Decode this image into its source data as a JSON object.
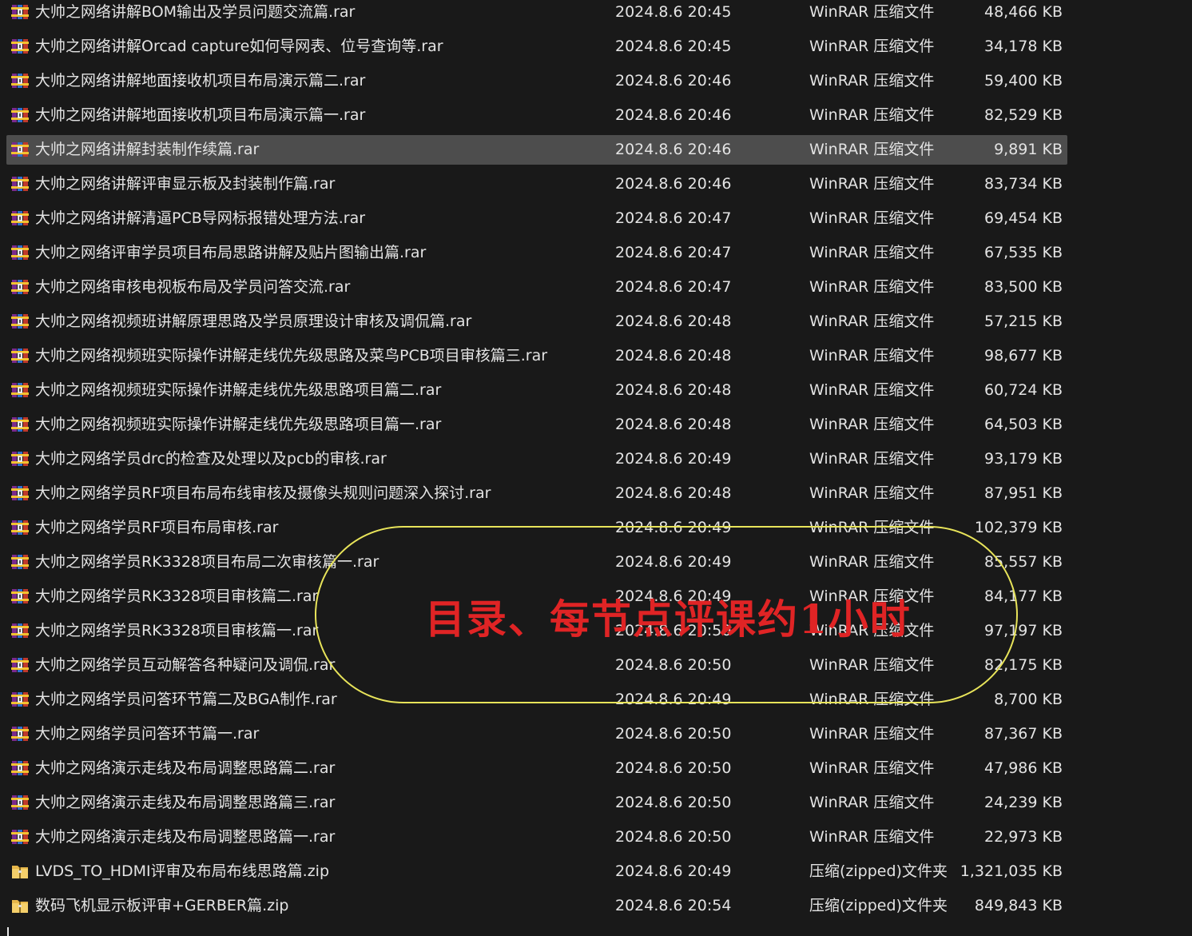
{
  "files": [
    {
      "name": "大帅之网络讲解BOM输出及学员问题交流篇.rar",
      "date": "2024.8.6 20:45",
      "type": "WinRAR 压缩文件",
      "size": "48,466 KB",
      "icon": "winrar-archive-icon"
    },
    {
      "name": "大帅之网络讲解Orcad capture如何导网表、位号查询等.rar",
      "date": "2024.8.6 20:45",
      "type": "WinRAR 压缩文件",
      "size": "34,178 KB",
      "icon": "winrar-archive-icon"
    },
    {
      "name": "大帅之网络讲解地面接收机项目布局演示篇二.rar",
      "date": "2024.8.6 20:46",
      "type": "WinRAR 压缩文件",
      "size": "59,400 KB",
      "icon": "winrar-archive-icon"
    },
    {
      "name": "大帅之网络讲解地面接收机项目布局演示篇一.rar",
      "date": "2024.8.6 20:46",
      "type": "WinRAR 压缩文件",
      "size": "82,529 KB",
      "icon": "winrar-archive-icon"
    },
    {
      "name": "大帅之网络讲解封装制作续篇.rar",
      "date": "2024.8.6 20:46",
      "type": "WinRAR 压缩文件",
      "size": "9,891 KB",
      "icon": "winrar-archive-icon",
      "selected": true
    },
    {
      "name": "大帅之网络讲解评审显示板及封装制作篇.rar",
      "date": "2024.8.6 20:46",
      "type": "WinRAR 压缩文件",
      "size": "83,734 KB",
      "icon": "winrar-archive-icon"
    },
    {
      "name": "大帅之网络讲解清逼PCB导网标报错处理方法.rar",
      "date": "2024.8.6 20:47",
      "type": "WinRAR 压缩文件",
      "size": "69,454 KB",
      "icon": "winrar-archive-icon"
    },
    {
      "name": "大帅之网络评审学员项目布局思路讲解及贴片图输出篇.rar",
      "date": "2024.8.6 20:47",
      "type": "WinRAR 压缩文件",
      "size": "67,535 KB",
      "icon": "winrar-archive-icon"
    },
    {
      "name": "大帅之网络审核电视板布局及学员问答交流.rar",
      "date": "2024.8.6 20:47",
      "type": "WinRAR 压缩文件",
      "size": "83,500 KB",
      "icon": "winrar-archive-icon"
    },
    {
      "name": "大帅之网络视频班讲解原理思路及学员原理设计审核及调侃篇.rar",
      "date": "2024.8.6 20:48",
      "type": "WinRAR 压缩文件",
      "size": "57,215 KB",
      "icon": "winrar-archive-icon"
    },
    {
      "name": "大帅之网络视频班实际操作讲解走线优先级思路及菜鸟PCB项目审核篇三.rar",
      "date": "2024.8.6 20:48",
      "type": "WinRAR 压缩文件",
      "size": "98,677 KB",
      "icon": "winrar-archive-icon"
    },
    {
      "name": "大帅之网络视频班实际操作讲解走线优先级思路项目篇二.rar",
      "date": "2024.8.6 20:48",
      "type": "WinRAR 压缩文件",
      "size": "60,724 KB",
      "icon": "winrar-archive-icon"
    },
    {
      "name": "大帅之网络视频班实际操作讲解走线优先级思路项目篇一.rar",
      "date": "2024.8.6 20:48",
      "type": "WinRAR 压缩文件",
      "size": "64,503 KB",
      "icon": "winrar-archive-icon"
    },
    {
      "name": "大帅之网络学员drc的检查及处理以及pcb的审核.rar",
      "date": "2024.8.6 20:49",
      "type": "WinRAR 压缩文件",
      "size": "93,179 KB",
      "icon": "winrar-archive-icon"
    },
    {
      "name": "大帅之网络学员RF项目布局布线审核及摄像头规则问题深入探讨.rar",
      "date": "2024.8.6 20:48",
      "type": "WinRAR 压缩文件",
      "size": "87,951 KB",
      "icon": "winrar-archive-icon"
    },
    {
      "name": "大帅之网络学员RF项目布局审核.rar",
      "date": "2024.8.6 20:49",
      "type": "WinRAR 压缩文件",
      "size": "102,379 KB",
      "icon": "winrar-archive-icon"
    },
    {
      "name": "大帅之网络学员RK3328项目布局二次审核篇一.rar",
      "date": "2024.8.6 20:49",
      "type": "WinRAR 压缩文件",
      "size": "85,557 KB",
      "icon": "winrar-archive-icon"
    },
    {
      "name": "大帅之网络学员RK3328项目审核篇二.rar",
      "date": "2024.8.6 20:49",
      "type": "WinRAR 压缩文件",
      "size": "84,177 KB",
      "icon": "winrar-archive-icon"
    },
    {
      "name": "大帅之网络学员RK3328项目审核篇一.rar",
      "date": "2024.8.6 20:50",
      "type": "WinRAR 压缩文件",
      "size": "97,197 KB",
      "icon": "winrar-archive-icon"
    },
    {
      "name": "大帅之网络学员互动解答各种疑问及调侃.rar",
      "date": "2024.8.6 20:50",
      "type": "WinRAR 压缩文件",
      "size": "82,175 KB",
      "icon": "winrar-archive-icon"
    },
    {
      "name": "大帅之网络学员问答环节篇二及BGA制作.rar",
      "date": "2024.8.6 20:49",
      "type": "WinRAR 压缩文件",
      "size": "8,700 KB",
      "icon": "winrar-archive-icon"
    },
    {
      "name": "大帅之网络学员问答环节篇一.rar",
      "date": "2024.8.6 20:50",
      "type": "WinRAR 压缩文件",
      "size": "87,367 KB",
      "icon": "winrar-archive-icon"
    },
    {
      "name": "大帅之网络演示走线及布局调整思路篇二.rar",
      "date": "2024.8.6 20:50",
      "type": "WinRAR 压缩文件",
      "size": "47,986 KB",
      "icon": "winrar-archive-icon"
    },
    {
      "name": "大帅之网络演示走线及布局调整思路篇三.rar",
      "date": "2024.8.6 20:50",
      "type": "WinRAR 压缩文件",
      "size": "24,239 KB",
      "icon": "winrar-archive-icon"
    },
    {
      "name": "大帅之网络演示走线及布局调整思路篇一.rar",
      "date": "2024.8.6 20:50",
      "type": "WinRAR 压缩文件",
      "size": "22,973 KB",
      "icon": "winrar-archive-icon"
    },
    {
      "name": "LVDS_TO_HDMI评审及布局布线思路篇.zip",
      "date": "2024.8.6 20:49",
      "type": "压缩(zipped)文件夹",
      "size": "1,321,035 KB",
      "icon": "zip-folder-icon"
    },
    {
      "name": "数码飞机显示板评审+GERBER篇.zip",
      "date": "2024.8.6 20:54",
      "type": "压缩(zipped)文件夹",
      "size": "849,843 KB",
      "icon": "zip-folder-icon"
    }
  ],
  "annotation": {
    "text": "目录、每节点评课约1小时",
    "text_color": "#e02425",
    "outline_color": "#e8e45a"
  },
  "colors": {
    "background": "#191919",
    "selected_row": "#4d4d4d",
    "text": "#e3e3e3"
  }
}
